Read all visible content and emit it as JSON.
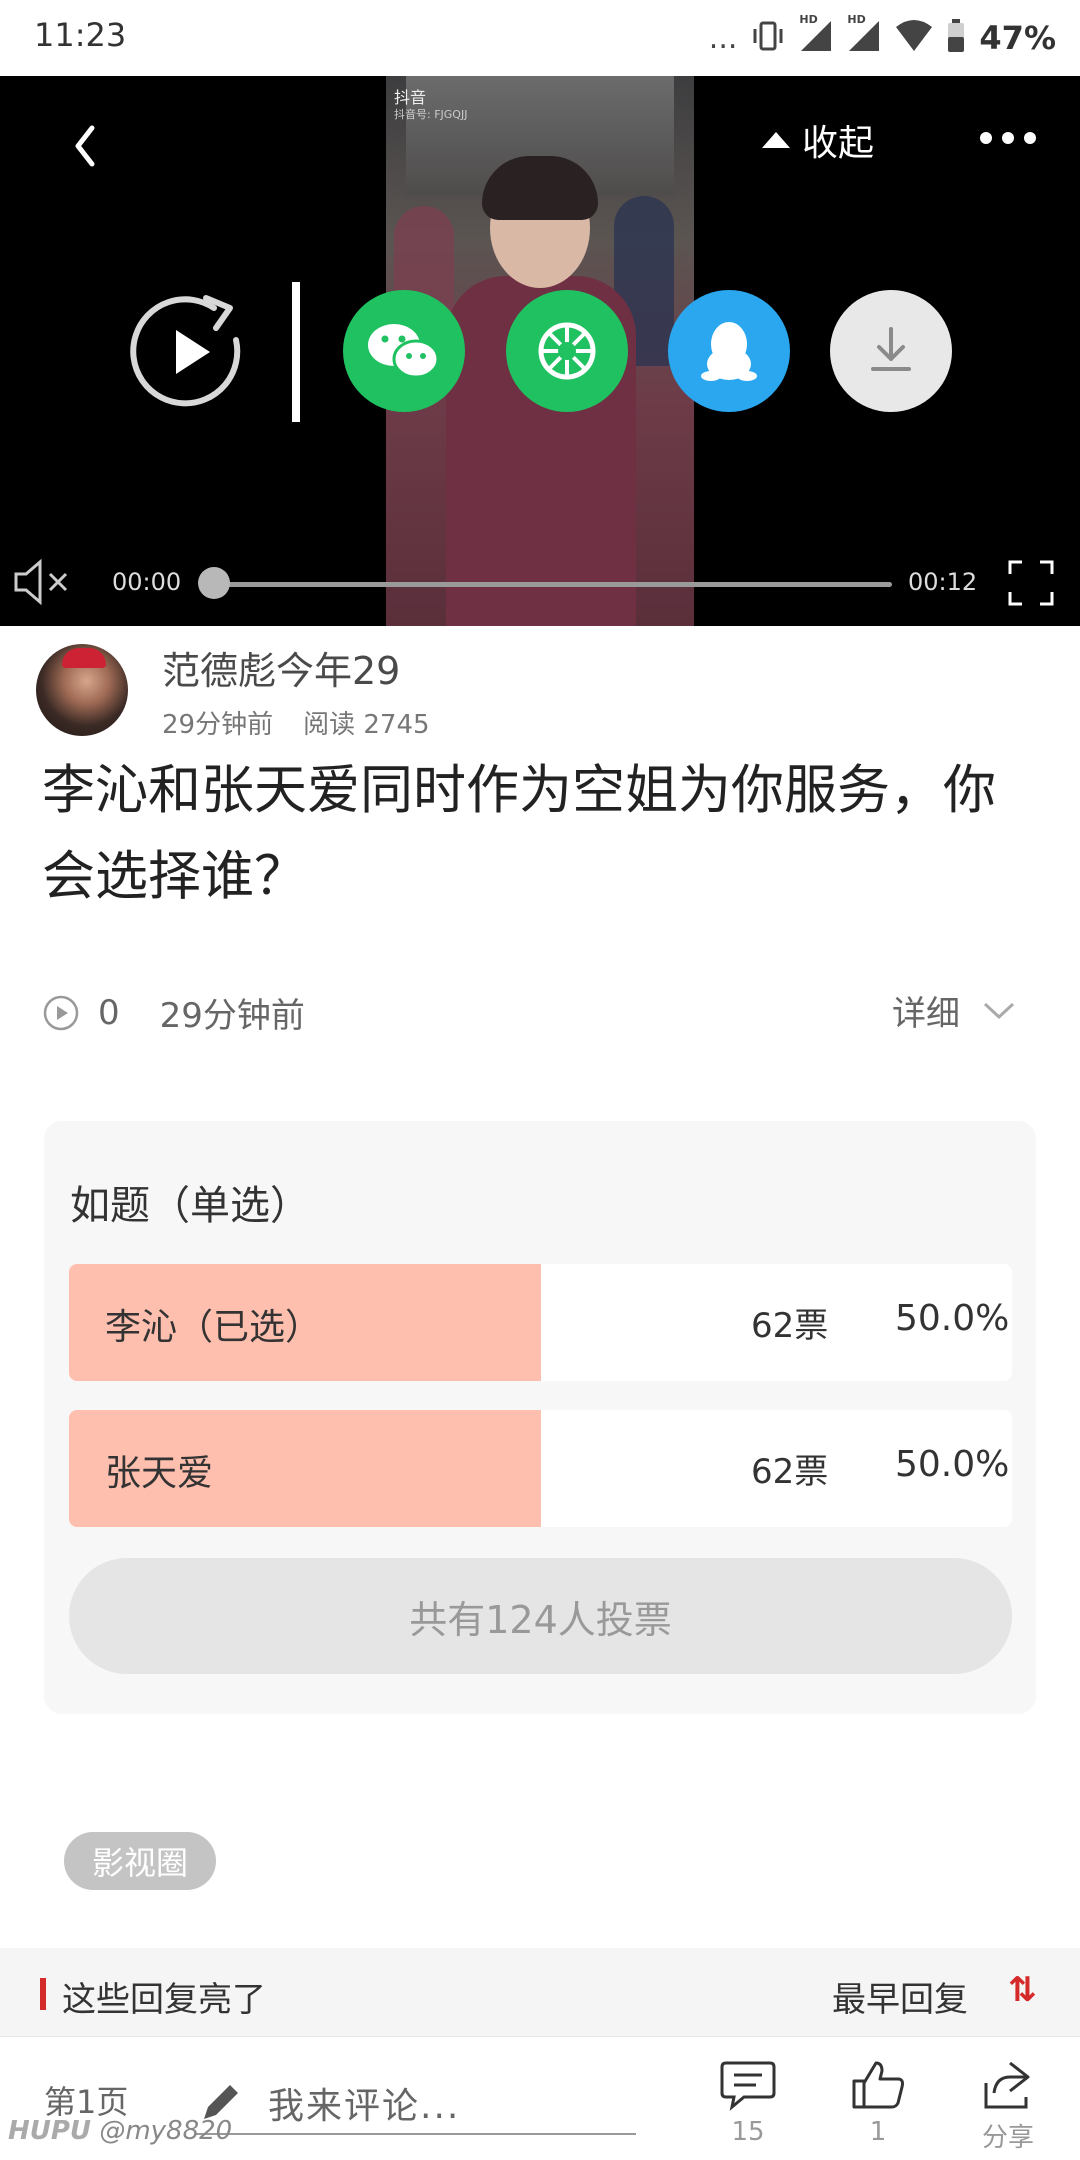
{
  "status_bar": {
    "time": "11:23",
    "signal_dots": "...",
    "network_label_1": "HD",
    "network_label_2": "HD",
    "battery_percent": "47%"
  },
  "video": {
    "collapse_label": "收起",
    "watermark_app": "抖音",
    "watermark_id": "抖音号: FJGQJJ",
    "current_time": "00:00",
    "duration": "00:12",
    "progress": 0,
    "share_targets": [
      "wechat",
      "wechat-moments",
      "qq",
      "download"
    ]
  },
  "post": {
    "author": "范德彪今年29",
    "time_ago": "29分钟前",
    "reads": "阅读 2745",
    "title": "李沁和张天爱同时作为空姐为你服务，你会选择谁？",
    "play_count": "0",
    "stats_time": "29分钟前",
    "details_label": "详细"
  },
  "poll": {
    "title": "如题（单选）",
    "options": [
      {
        "label": "李沁（已选）",
        "votes": "62票",
        "percent": "50.0%",
        "share": 0.5,
        "selected": true
      },
      {
        "label": "张天爱",
        "votes": "62票",
        "percent": "50.0%",
        "share": 0.5,
        "selected": false
      }
    ],
    "total": "共有124人投票"
  },
  "tag": "影视圈",
  "replies": {
    "header": "这些回复亮了",
    "sort_label": "最早回复",
    "sort_icon": "⇅"
  },
  "bottom_bar": {
    "page": "第1页",
    "comment_placeholder": "我来评论...",
    "comments_count": "15",
    "likes_count": "1",
    "share_label": "分享"
  },
  "watermark": {
    "brand": "HUPU",
    "user": "@my8820"
  },
  "colors": {
    "poll_fill": "#ffbfaf",
    "accent_red": "#d42a2a",
    "wechat_green": "#1fc160",
    "qq_blue": "#2aa7ef"
  }
}
